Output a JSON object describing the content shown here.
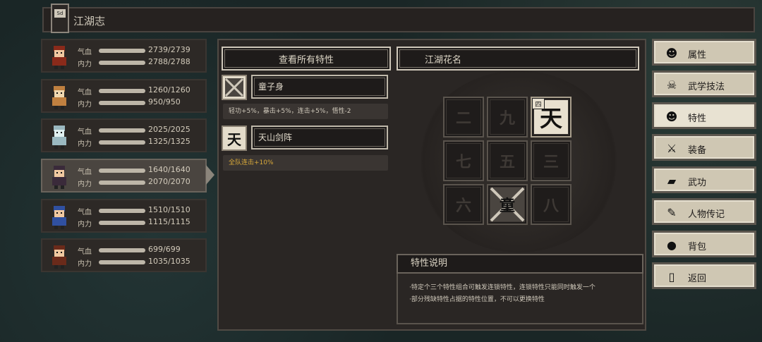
{
  "title": "江湖志",
  "title_icon_text": "Sd",
  "characters": [
    {
      "hp_label": "气血",
      "mp_label": "内力",
      "hp": "2739/2739",
      "mp": "2788/2788",
      "hp_ratio": 1.0,
      "mp_ratio": 1.0,
      "active": false
    },
    {
      "hp_label": "气血",
      "mp_label": "内力",
      "hp": "1260/1260",
      "mp": "950/950",
      "hp_ratio": 1.0,
      "mp_ratio": 1.0,
      "active": false
    },
    {
      "hp_label": "气血",
      "mp_label": "内力",
      "hp": "2025/2025",
      "mp": "1325/1325",
      "hp_ratio": 1.0,
      "mp_ratio": 1.0,
      "active": false
    },
    {
      "hp_label": "气血",
      "mp_label": "内力",
      "hp": "1640/1640",
      "mp": "2070/2070",
      "hp_ratio": 1.0,
      "mp_ratio": 1.0,
      "active": true
    },
    {
      "hp_label": "气血",
      "mp_label": "内力",
      "hp": "1510/1510",
      "mp": "1115/1115",
      "hp_ratio": 1.0,
      "mp_ratio": 1.0,
      "active": false
    },
    {
      "hp_label": "气血",
      "mp_label": "内力",
      "hp": "699/699",
      "mp": "1035/1035",
      "hp_ratio": 1.0,
      "mp_ratio": 1.0,
      "active": false
    }
  ],
  "view_all_traits": "查看所有特性",
  "jianghu_nickname": "江湖花名",
  "traits": [
    {
      "name": "童子身",
      "icon_char": "",
      "desc": "轻功+5%，暴击+5%，连击+5%，悟性-2",
      "desc_gold": false
    },
    {
      "name": "天山剑阵",
      "icon_char": "天",
      "desc": "全队连击+10%",
      "desc_gold": true
    }
  ],
  "grid": [
    {
      "char": "二",
      "lit": false,
      "tag": ""
    },
    {
      "char": "九",
      "lit": false,
      "tag": ""
    },
    {
      "char": "天",
      "lit": true,
      "tag": "四"
    },
    {
      "char": "七",
      "lit": false,
      "tag": ""
    },
    {
      "char": "五",
      "lit": false,
      "tag": ""
    },
    {
      "char": "三",
      "lit": false,
      "tag": ""
    },
    {
      "char": "六",
      "lit": false,
      "tag": ""
    },
    {
      "char": "童",
      "lit": false,
      "tag": "",
      "special": true
    },
    {
      "char": "八",
      "lit": false,
      "tag": ""
    }
  ],
  "trait_explain": {
    "title": "特性说明",
    "lines": [
      "·特定个三个特性组合可触发连锁特性，连锁特性只能同时触发一个",
      "·部分残缺特性占据的特性位置，不可以更换特性"
    ]
  },
  "menu": [
    {
      "label": "属性",
      "icon": "person-icon",
      "selected": false
    },
    {
      "label": "武学技法",
      "icon": "skull-icon",
      "selected": false
    },
    {
      "label": "特性",
      "icon": "trait-icon",
      "selected": true
    },
    {
      "label": "装备",
      "icon": "sword-icon",
      "selected": false
    },
    {
      "label": "武功",
      "icon": "book-icon",
      "selected": false
    },
    {
      "label": "人物传记",
      "icon": "scroll-icon",
      "selected": false
    },
    {
      "label": "背包",
      "icon": "bag-icon",
      "selected": false
    },
    {
      "label": "返回",
      "icon": "door-icon",
      "selected": false
    }
  ],
  "colors": {
    "panel": "#2a2624",
    "accent_gold": "#d9a93a",
    "lit_cell": "#e8e0cf",
    "menu_bg": "#cfc7b3"
  }
}
